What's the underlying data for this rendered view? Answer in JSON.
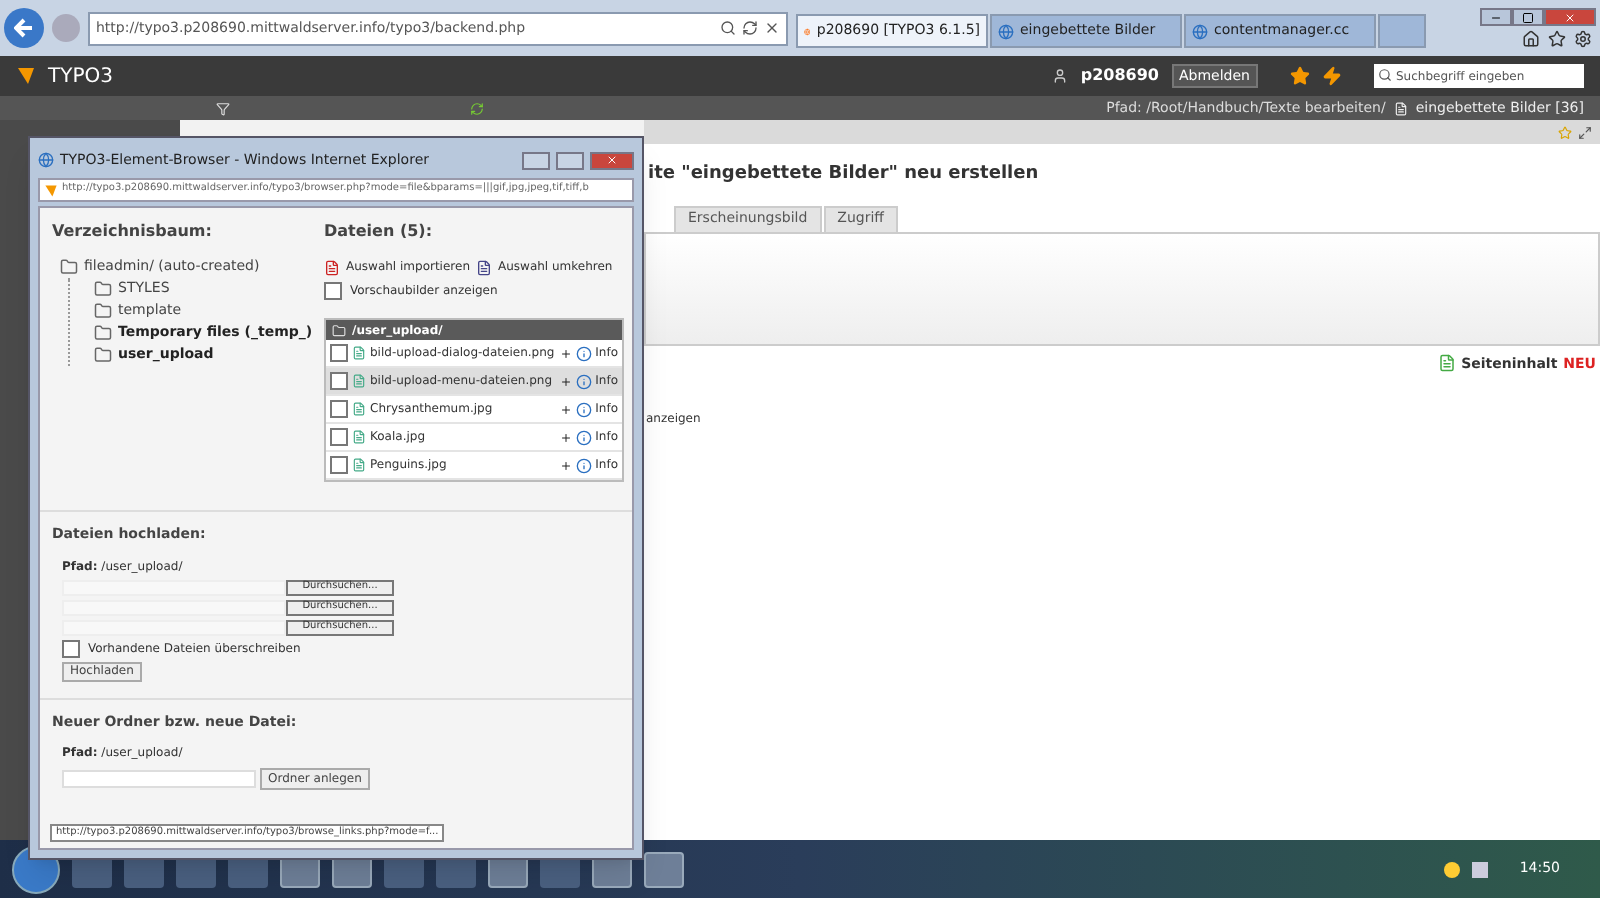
{
  "browser": {
    "url": "http://typo3.p208690.mittwaldserver.info/typo3/backend.php",
    "tabs": [
      {
        "label": "p208690 [TYPO3 6.1.5]",
        "selected": true
      },
      {
        "label": "eingebettete Bilder",
        "selected": false
      },
      {
        "label": "contentmanager.cc",
        "selected": false
      }
    ]
  },
  "header": {
    "logo": "TYPO3",
    "user": "p208690",
    "logout": "Abmelden",
    "search": {
      "placeholder": "Suchbegriff eingeben"
    }
  },
  "path_bar": {
    "path": "Pfad: /Root/Handbuch/Texte bearbeiten/",
    "page": "eingebettete Bilder [36]"
  },
  "main": {
    "heading": "ite \"eingebettete Bilder\" neu erstellen",
    "tabs": [
      {
        "label": "Erscheinungsbild",
        "selected": false
      },
      {
        "label": "Zugriff",
        "selected": false
      }
    ],
    "new_content": "Seiteninhalt",
    "new_badge": "NEU",
    "fragment": "anzeigen"
  },
  "popup": {
    "title": "TYPO3-Element-Browser - Windows Internet Explorer",
    "url": "http://typo3.p208690.mittwaldserver.info/typo3/browser.php?mode=file&bparams=|||gif,jpg,jpeg,tif,tiff,b",
    "tree_heading": "Verzeichnisbaum:",
    "tree": [
      {
        "label": "fileadmin/ (auto-created)",
        "bold": false,
        "children": [
          {
            "label": "STYLES",
            "bold": false
          },
          {
            "label": "template",
            "bold": false
          },
          {
            "label": "Temporary files (_temp_)",
            "bold": true
          },
          {
            "label": "user_upload",
            "bold": true
          }
        ]
      }
    ],
    "files_heading": "Dateien (5):",
    "import": "Auswahl importieren",
    "invert": "Auswahl umkehren",
    "thumbnails": {
      "label": "Vorschaubilder anzeigen",
      "checked": false
    },
    "folder": "/user_upload/",
    "files": [
      {
        "name": "bild-upload-dialog-dateien.png",
        "checked": false,
        "selected": false,
        "info": "Info"
      },
      {
        "name": "bild-upload-menu-dateien.png",
        "checked": false,
        "selected": true,
        "info": "Info"
      },
      {
        "name": "Chrysanthemum.jpg",
        "checked": false,
        "selected": false,
        "info": "Info"
      },
      {
        "name": "Koala.jpg",
        "checked": false,
        "selected": false,
        "info": "Info"
      },
      {
        "name": "Penguins.jpg",
        "checked": false,
        "selected": false,
        "info": "Info"
      }
    ],
    "upload_heading": "Dateien hochladen:",
    "upload_path": "**Pfad:** /user_upload/",
    "browse_buttons": [
      "Durchsuchen...",
      "Durchsuchen...",
      "Durchsuchen..."
    ],
    "overwrite": {
      "label": "Vorhandene Dateien überschreiben",
      "checked": false
    },
    "upload_button": "Hochladen",
    "new_heading": "Neuer Ordner bzw. neue Datei:",
    "new_path": "**Pfad:** /user_upload/",
    "create_button": "Ordner anlegen",
    "status": "http://typo3.p208690.mittwaldserver.info/typo3/browse_links.php?mode=f..."
  },
  "taskbar": {
    "clock": "14:50"
  }
}
